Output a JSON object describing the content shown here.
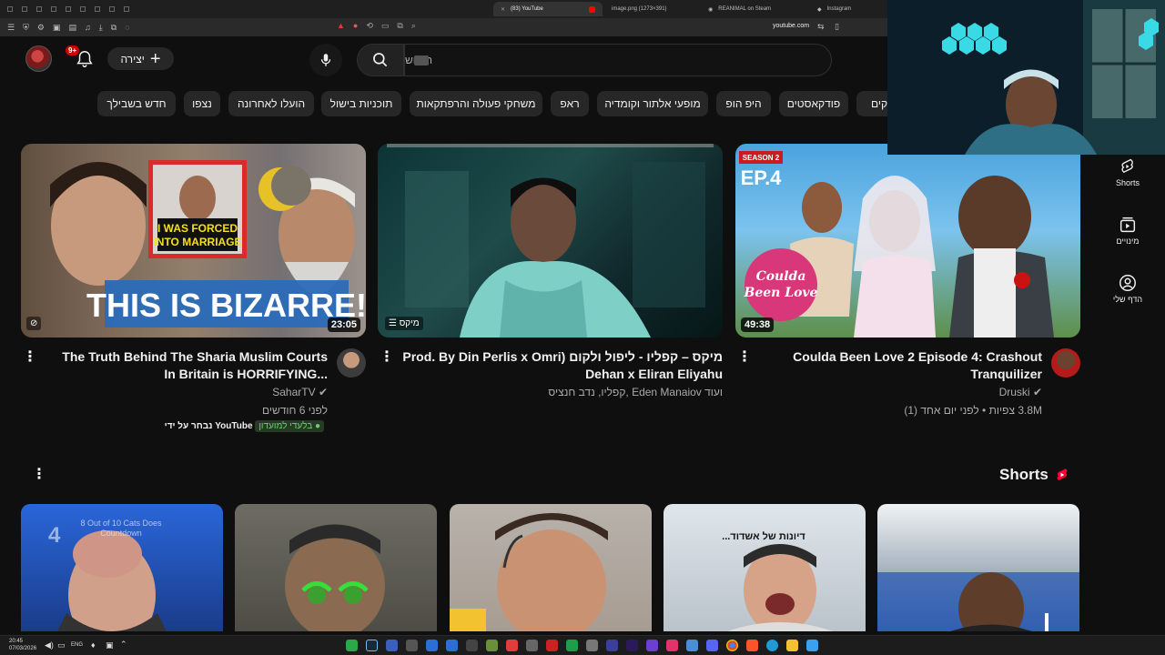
{
  "browser": {
    "tabs": [
      {
        "label": "(83) YouTube",
        "active": true
      },
      {
        "label": "image.png (1273×391)",
        "active": false
      },
      {
        "label": "REANIMAL on Steam",
        "active": false
      },
      {
        "label": "Instagram",
        "active": false
      }
    ],
    "url": "youtube.com"
  },
  "header": {
    "notification_badge": "9+",
    "create_label": "יצירה",
    "search_placeholder": "חיפוש"
  },
  "chips": [
    "חדש בשבילך",
    "נצפו",
    "הועלו לאחרונה",
    "תוכניות בישול",
    "משחקי פעולה והרפתקאות",
    "ראפ",
    "מופעי אלתור וקומדיה",
    "היפ הופ",
    "פודקאסטים",
    "קים"
  ],
  "videos": [
    {
      "title": "The Truth Behind The Sharia Muslim Courts In Britain is HORRIFYING...",
      "channel": "SaharTV",
      "meta": "לפני 6 חודשים",
      "duration": "23:05",
      "badge_members": "בלעדי למועדון",
      "badge_youtube": "נבחר על ידי YouTube",
      "thumb_text": "THIS IS BIZARRE!",
      "thumb_inset_text": "I WAS FORCED INTO MARRIAGE"
    },
    {
      "title": "מיקס – קפליו - ליפול ולקום (Prod. By Din Perlis x Omri Dehan x Eliran Eliyahu",
      "channel": "קפליו, נדב חנציס, Eden Manaiov ועוד",
      "meta": "",
      "duration": "מיקס"
    },
    {
      "title": "Coulda Been Love 2 Episode 4: Crashout Tranquilizer",
      "channel": "Druski",
      "meta": "3.8M צפיות • לפני יום אחד (1)",
      "duration": "49:38",
      "thumb_season": "SEASON 2",
      "thumb_ep": "EP.4",
      "thumb_logo": "Coulda Been Love 2"
    }
  ],
  "shorts": {
    "title": "Shorts",
    "items": [
      {
        "caption": "8 Out of 10 Cats Does Countdown"
      },
      {
        "caption": ""
      },
      {
        "caption": ""
      },
      {
        "caption": "דיונות של אשדוד..."
      },
      {
        "caption": ""
      }
    ]
  },
  "guide": [
    {
      "label": "Shorts",
      "icon": "shorts-icon"
    },
    {
      "label": "מינויים",
      "icon": "subscriptions-icon"
    },
    {
      "label": "הדף שלי",
      "icon": "you-icon"
    }
  ],
  "taskbar": {
    "time": "20:45",
    "date": "07/03/2026",
    "lang": "ENG"
  },
  "colors": {
    "background": "#0f0f0f",
    "chip": "#272727",
    "accent": "#ff0000"
  }
}
